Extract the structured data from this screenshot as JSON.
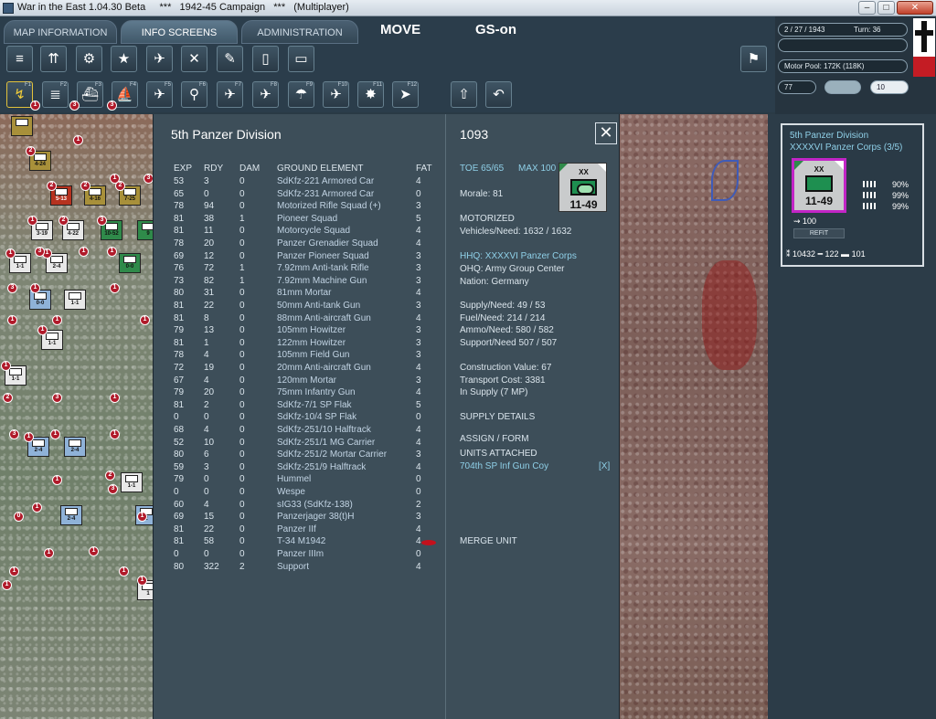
{
  "window": {
    "title": "War in the East 1.04.30 Beta     ***   1942-45 Campaign   ***   (Multiplayer)",
    "minimize": "–",
    "maximize": "□",
    "close": "✕"
  },
  "tabs": [
    {
      "label": "MAP INFORMATION"
    },
    {
      "label": "INFO SCREENS"
    },
    {
      "label": "ADMINISTRATION"
    }
  ],
  "mode": {
    "move": "MOVE",
    "gs": "GS-on"
  },
  "status": {
    "date": "2 / 27 / 1943",
    "turn": "Turn: 36",
    "motor_pool": "Motor Pool:  172K (118K)",
    "value_left": "77",
    "value_right": "10"
  },
  "toolbar_row2_keys": [
    "F1",
    "F2",
    "F3",
    "F4",
    "F5",
    "F6",
    "F7",
    "F8",
    "F9",
    "F10",
    "F11",
    "F12"
  ],
  "division": {
    "name": "5th Panzer Division",
    "id_number": "1093",
    "close": "✕",
    "counter": {
      "size": "XX",
      "strength": "11-49"
    },
    "columns": {
      "exp": "EXP",
      "rdy": "RDY",
      "dam": "DAM",
      "ground": "GROUND ELEMENT",
      "fat": "FAT"
    },
    "elements": [
      {
        "exp": "53",
        "rdy": "3",
        "dam": "0",
        "name": "SdKfz-221 Armored Car",
        "fat": "4"
      },
      {
        "exp": "65",
        "rdy": "0",
        "dam": "0",
        "name": "SdKfz-231 Armored Car",
        "fat": "0"
      },
      {
        "exp": "78",
        "rdy": "94",
        "dam": "0",
        "name": "Motorized Rifle Squad (+)",
        "fat": "3"
      },
      {
        "exp": "81",
        "rdy": "38",
        "dam": "1",
        "name": "Pioneer Squad",
        "fat": "5"
      },
      {
        "exp": "81",
        "rdy": "11",
        "dam": "0",
        "name": "Motorcycle Squad",
        "fat": "4"
      },
      {
        "exp": "78",
        "rdy": "20",
        "dam": "0",
        "name": "Panzer Grenadier Squad",
        "fat": "4"
      },
      {
        "exp": "69",
        "rdy": "12",
        "dam": "0",
        "name": "Panzer Pioneer Squad",
        "fat": "3"
      },
      {
        "exp": "76",
        "rdy": "72",
        "dam": "1",
        "name": "7.92mm Anti-tank Rifle",
        "fat": "3"
      },
      {
        "exp": "73",
        "rdy": "82",
        "dam": "1",
        "name": "7.92mm Machine Gun",
        "fat": "3"
      },
      {
        "exp": "80",
        "rdy": "31",
        "dam": "0",
        "name": "81mm Mortar",
        "fat": "4"
      },
      {
        "exp": "81",
        "rdy": "22",
        "dam": "0",
        "name": "50mm Anti-tank Gun",
        "fat": "3"
      },
      {
        "exp": "81",
        "rdy": "8",
        "dam": "0",
        "name": "88mm Anti-aircraft Gun",
        "fat": "4"
      },
      {
        "exp": "79",
        "rdy": "13",
        "dam": "0",
        "name": "105mm Howitzer",
        "fat": "3"
      },
      {
        "exp": "81",
        "rdy": "1",
        "dam": "0",
        "name": "122mm Howitzer",
        "fat": "3"
      },
      {
        "exp": "78",
        "rdy": "4",
        "dam": "0",
        "name": "105mm Field Gun",
        "fat": "3"
      },
      {
        "exp": "72",
        "rdy": "19",
        "dam": "0",
        "name": "20mm Anti-aircraft Gun",
        "fat": "4"
      },
      {
        "exp": "67",
        "rdy": "4",
        "dam": "0",
        "name": "120mm Mortar",
        "fat": "3"
      },
      {
        "exp": "79",
        "rdy": "20",
        "dam": "0",
        "name": "75mm Infantry Gun",
        "fat": "4"
      },
      {
        "exp": "81",
        "rdy": "2",
        "dam": "0",
        "name": "SdKfz-7/1 SP Flak",
        "fat": "5"
      },
      {
        "exp": "0",
        "rdy": "0",
        "dam": "0",
        "name": "SdKfz-10/4 SP Flak",
        "fat": "0"
      },
      {
        "exp": "68",
        "rdy": "4",
        "dam": "0",
        "name": "SdKfz-251/10 Halftrack",
        "fat": "4"
      },
      {
        "exp": "52",
        "rdy": "10",
        "dam": "0",
        "name": "SdKfz-251/1 MG Carrier",
        "fat": "4"
      },
      {
        "exp": "80",
        "rdy": "6",
        "dam": "0",
        "name": "SdKfz-251/2 Mortar Carrier",
        "fat": "3"
      },
      {
        "exp": "59",
        "rdy": "3",
        "dam": "0",
        "name": "SdKfz-251/9 Halftrack",
        "fat": "4"
      },
      {
        "exp": "79",
        "rdy": "0",
        "dam": "0",
        "name": "Hummel",
        "fat": "0"
      },
      {
        "exp": "0",
        "rdy": "0",
        "dam": "0",
        "name": "Wespe",
        "fat": "0"
      },
      {
        "exp": "60",
        "rdy": "4",
        "dam": "0",
        "name": "sIG33 (SdKfz-138)",
        "fat": "2"
      },
      {
        "exp": "69",
        "rdy": "15",
        "dam": "0",
        "name": "Panzerjager 38(t)H",
        "fat": "3"
      },
      {
        "exp": "81",
        "rdy": "22",
        "dam": "0",
        "name": "Panzer IIf",
        "fat": "4"
      },
      {
        "exp": "81",
        "rdy": "58",
        "dam": "0",
        "name": "T-34 M1942",
        "fat": "4"
      },
      {
        "exp": "0",
        "rdy": "0",
        "dam": "0",
        "name": "Panzer IIIm",
        "fat": "0"
      },
      {
        "exp": "80",
        "rdy": "322",
        "dam": "2",
        "name": "Support",
        "fat": "4"
      }
    ],
    "details": {
      "toe": "TOE 65/65",
      "max": "MAX 100",
      "morale": "Morale:   81",
      "type": "MOTORIZED",
      "vehicles": "Vehicles/Need:   1632 / 1632",
      "hhq": "HHQ: XXXXVI Panzer Corps",
      "ohq": "OHQ:  Army Group Center",
      "nation": "Nation:    Germany",
      "supply": "Supply/Need:    49 / 53",
      "fuel": "Fuel/Need:        214 / 214",
      "ammo": "Ammo/Need:     580 / 582",
      "support": "Support/Need     507 / 507",
      "construction": "Construction Value:   67",
      "transport": "Transport Cost:      3381",
      "in_supply": "In Supply (7 MP)",
      "supply_details": "SUPPLY DETAILS",
      "assign_form": "ASSIGN / FORM",
      "units_attached": "UNITS ATTACHED",
      "attached_unit": "704th SP Inf Gun Coy",
      "detach": "[X]",
      "merge": "MERGE UNIT"
    }
  },
  "unit_info": {
    "name": "5th Panzer Division",
    "corps": "XXXXVI Panzer Corps (3/5)",
    "counter": {
      "size": "XX",
      "strength": "11-49"
    },
    "percents": [
      "90%",
      "99%",
      "99%"
    ],
    "moves": "100",
    "refit": "REFIT",
    "men": "10432",
    "guns": "122",
    "tanks": "101"
  },
  "map_counters": [
    {
      "cls": "c-olive",
      "str": "",
      "mk": ""
    },
    {
      "cls": "c-olive",
      "str": "4-24",
      "mk": "2"
    },
    {
      "cls": "c-red",
      "str": "5-13",
      "mk": "2"
    },
    {
      "cls": "c-olive",
      "str": "4-16",
      "mk": "2"
    },
    {
      "cls": "c-olive",
      "str": "7-25",
      "mk": "2"
    },
    {
      "cls": "c-white",
      "str": "3-19",
      "mk": "1"
    },
    {
      "cls": "c-white",
      "str": "4-22",
      "mk": "2"
    },
    {
      "cls": "c-green",
      "str": "10-52",
      "mk": "3"
    },
    {
      "cls": "c-green",
      "str": "9",
      "mk": ""
    },
    {
      "cls": "c-white",
      "str": "1-1",
      "mk": "1"
    },
    {
      "cls": "c-white",
      "str": "2-4",
      "mk": "1"
    },
    {
      "cls": "c-green",
      "str": "0-0",
      "mk": ""
    },
    {
      "cls": "c-blue",
      "str": "0-0",
      "mk": ""
    },
    {
      "cls": "c-white",
      "str": "1-1",
      "mk": ""
    },
    {
      "cls": "c-white",
      "str": "1-1",
      "mk": "1"
    },
    {
      "cls": "c-white",
      "str": "1-1",
      "mk": "1"
    },
    {
      "cls": "c-blue",
      "str": "2-4",
      "mk": "1"
    },
    {
      "cls": "c-blue",
      "str": "2-4",
      "mk": ""
    },
    {
      "cls": "c-white",
      "str": "1-1",
      "mk": ""
    },
    {
      "cls": "c-blue",
      "str": "2-4",
      "mk": ""
    },
    {
      "cls": "c-blue",
      "str": "2",
      "mk": ""
    },
    {
      "cls": "c-white",
      "str": "1",
      "mk": ""
    }
  ],
  "map_markers": [
    "1",
    "3",
    "3",
    "1",
    "1",
    "3",
    "3",
    "1",
    "1",
    "3",
    "1",
    "1",
    "1",
    "1",
    "1",
    "2",
    "3",
    "1",
    "3",
    "1",
    "1",
    "2",
    "1",
    "1",
    "1",
    "0",
    "1",
    "1",
    "1",
    "1",
    "3",
    "1",
    "1"
  ]
}
